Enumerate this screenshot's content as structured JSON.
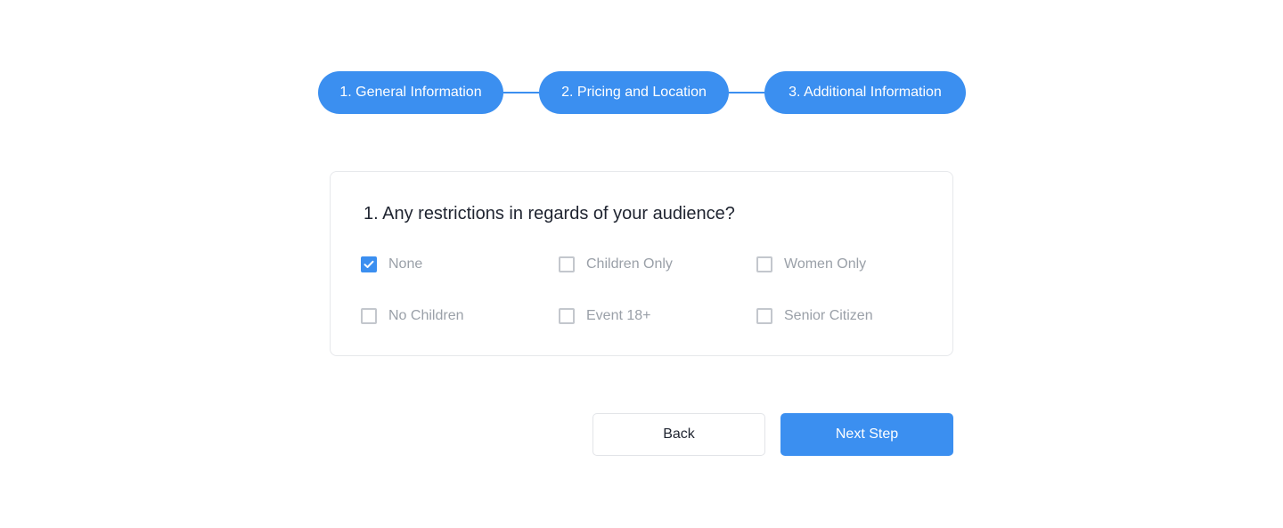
{
  "stepper": {
    "steps": [
      {
        "label": "1. General Information"
      },
      {
        "label": "2. Pricing and Location"
      },
      {
        "label": "3. Additional Information"
      }
    ]
  },
  "question": {
    "title": "1. Any restrictions in regards of your audience?",
    "options": [
      {
        "label": "None",
        "checked": true
      },
      {
        "label": "Children Only",
        "checked": false
      },
      {
        "label": "Women Only",
        "checked": false
      },
      {
        "label": "No Children",
        "checked": false
      },
      {
        "label": "Event 18+",
        "checked": false
      },
      {
        "label": "Senior Citizen",
        "checked": false
      }
    ]
  },
  "actions": {
    "back_label": "Back",
    "next_label": "Next Step"
  },
  "colors": {
    "accent": "#3b8ff0",
    "text_dark": "#1f2430",
    "text_muted": "#9aa0a8",
    "border": "#e6e8eb"
  }
}
